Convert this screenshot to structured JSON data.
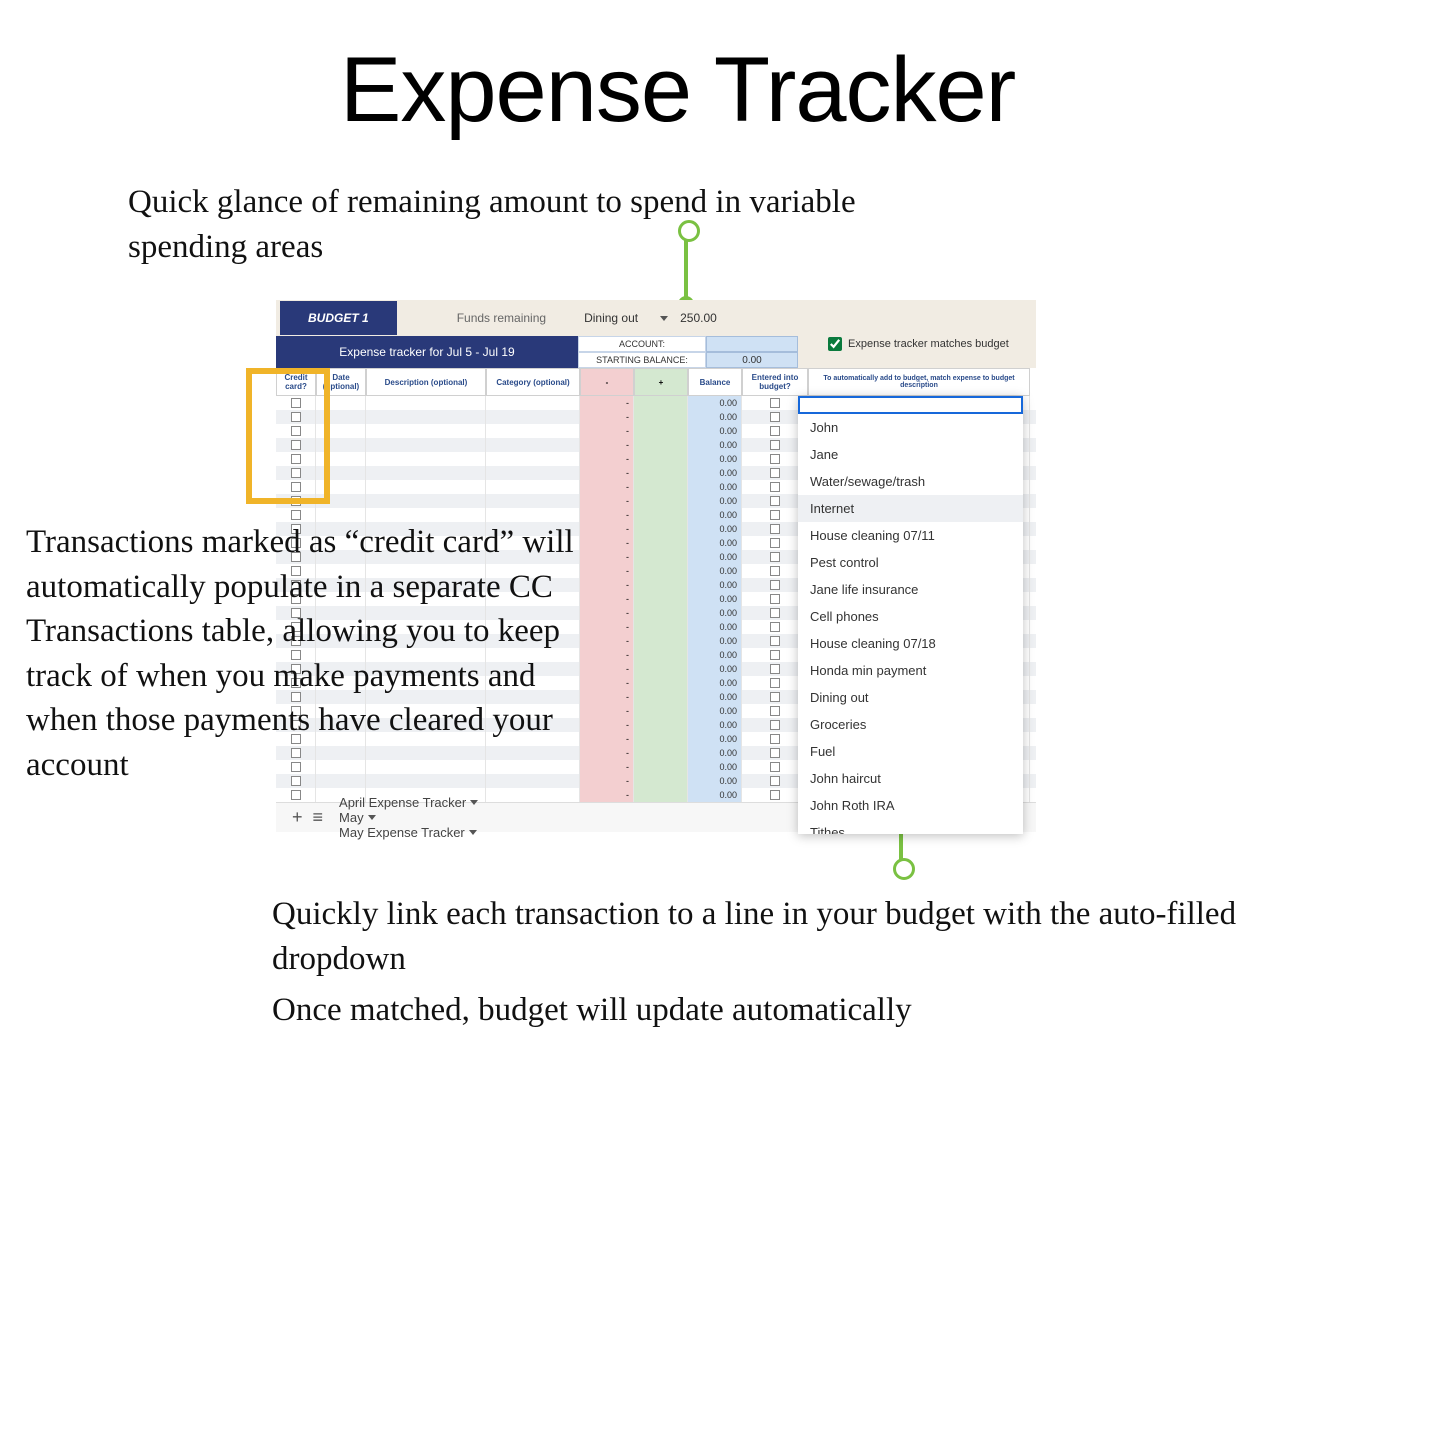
{
  "title": "Expense Tracker",
  "annotations": {
    "top": "Quick glance of remaining amount to spend in variable spending areas",
    "left": "Transactions marked as “credit card” will automatically populate in a separate CC Transactions table, allowing you to keep track of when you make payments and when those payments have cleared your account",
    "bot1": "Quickly link each transaction to a line in your budget with the auto-filled dropdown",
    "bot2": "Once matched, budget will update automatically"
  },
  "topbar": {
    "budget_tab": "BUDGET 1",
    "funds_label": "Funds remaining",
    "category": "Dining out",
    "amount": "250.00"
  },
  "header": {
    "tracker_title": "Expense tracker for Jul 5 - Jul 19",
    "account_label": "ACCOUNT:",
    "starting_label": "STARTING BALANCE:",
    "starting_value": "0.00",
    "matches_label": "Expense tracker matches budget"
  },
  "columns": {
    "cc": "Credit card?",
    "date": "Date (optional)",
    "desc": "Description (optional)",
    "cat": "Category (optional)",
    "minus": "-",
    "plus": "+",
    "bal": "Balance",
    "ent": "Entered into budget?",
    "match": "To automatically add to budget, match expense to budget description"
  },
  "row_defaults": {
    "minus": "-",
    "bal": "0.00"
  },
  "row_count": 29,
  "dropdown_items": [
    "John",
    "Jane",
    "Water/sewage/trash",
    "Internet",
    "House cleaning 07/11",
    "Pest control",
    "Jane life insurance",
    "Cell phones",
    "House cleaning 07/18",
    "Honda min payment",
    "Dining out",
    "Groceries",
    "Fuel",
    "John haircut",
    "John Roth IRA",
    "Tithes"
  ],
  "dropdown_selected_index": 3,
  "sheet_tabs": [
    "April Expense Tracker",
    "May",
    "May Expense Tracker"
  ]
}
